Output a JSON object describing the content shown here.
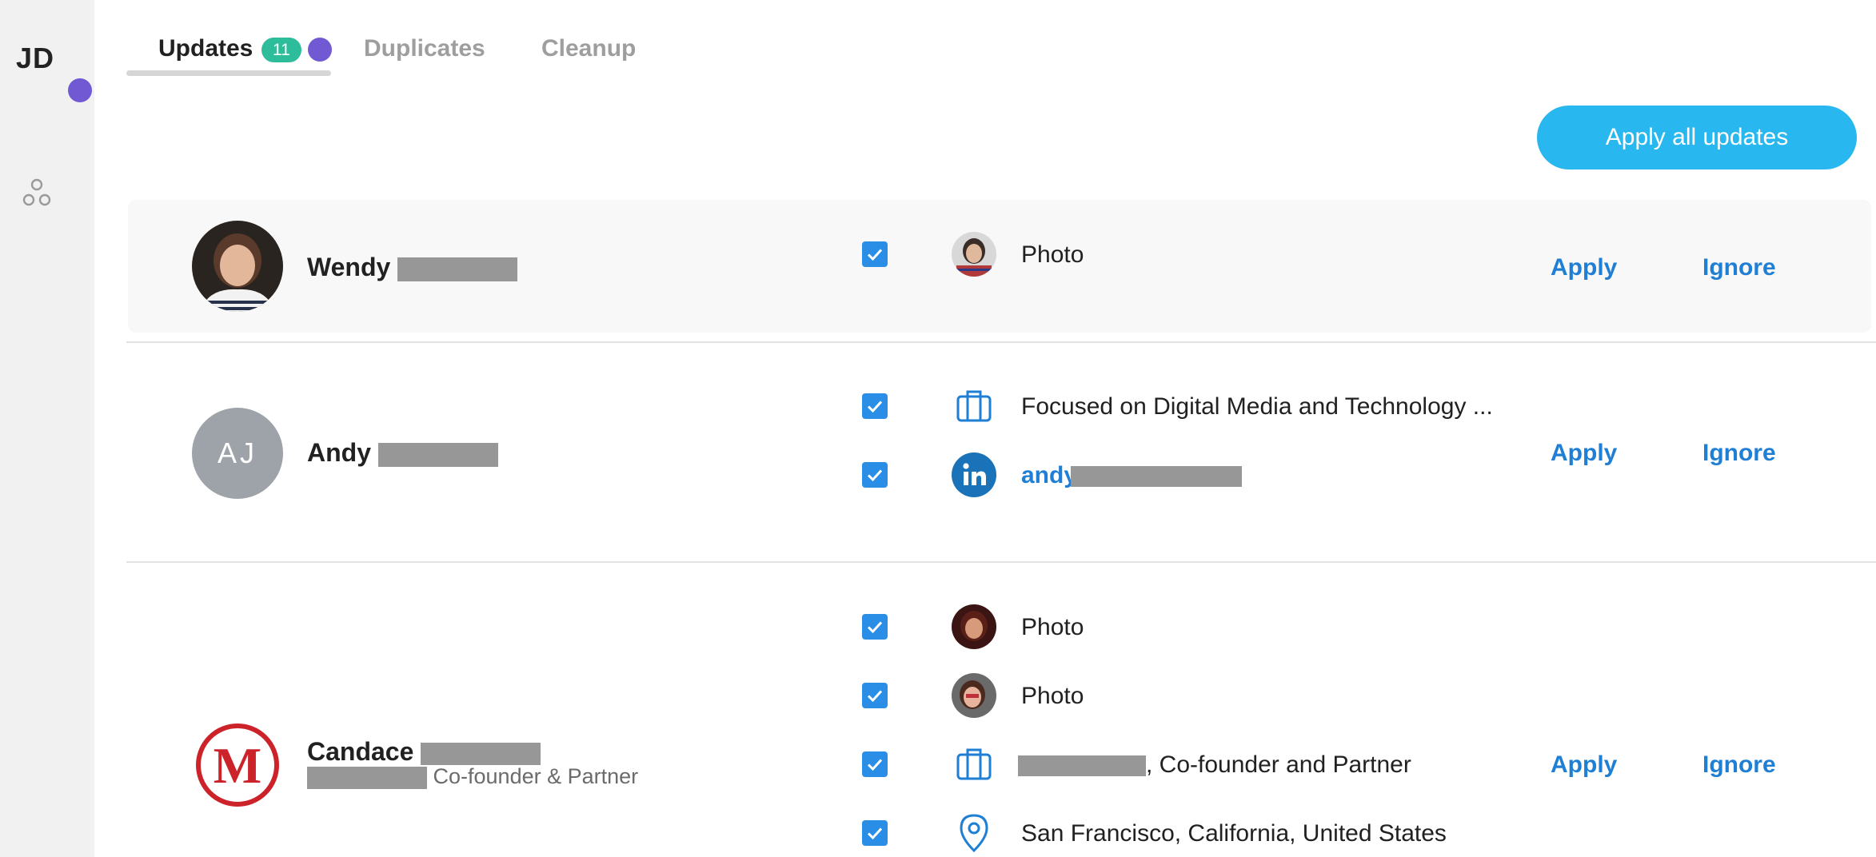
{
  "sidebar": {
    "user_initials": "JD",
    "nav_icon": "contacts-cluster-icon"
  },
  "tabs": [
    {
      "label": "Updates",
      "badge": "11",
      "active": true
    },
    {
      "label": "Duplicates",
      "active": false
    },
    {
      "label": "Cleanup",
      "active": false
    }
  ],
  "toolbar": {
    "apply_all_label": "Apply all updates"
  },
  "colors": {
    "accent": "#28b7ee",
    "link": "#1e7fd4",
    "badge": "#2ebd9b",
    "notification": "#7159d3",
    "checkbox": "#2a8ee6"
  },
  "actions": {
    "apply": "Apply",
    "ignore": "Ignore"
  },
  "rows": [
    {
      "first_name": "Wendy",
      "avatar": "photo",
      "updates": [
        {
          "icon": "photo-thumb",
          "text": "Photo",
          "checked": true
        }
      ]
    },
    {
      "first_name": "Andy",
      "avatar_initials": "AJ",
      "updates": [
        {
          "icon": "briefcase-icon",
          "text": "Focused on Digital Media and Technology ...",
          "checked": true
        },
        {
          "icon": "linkedin-icon",
          "text": "andy",
          "checked": true
        }
      ]
    },
    {
      "first_name": "Candace",
      "subtitle": "Co-founder & Partner",
      "avatar": "logo-m",
      "updates": [
        {
          "icon": "photo-thumb",
          "text": "Photo",
          "checked": true
        },
        {
          "icon": "photo-thumb",
          "text": "Photo",
          "checked": true
        },
        {
          "icon": "briefcase-icon",
          "text": ", Co-founder and Partner",
          "checked": true
        },
        {
          "icon": "location-pin-icon",
          "text": "San Francisco, California, United States",
          "checked": true
        }
      ]
    }
  ]
}
